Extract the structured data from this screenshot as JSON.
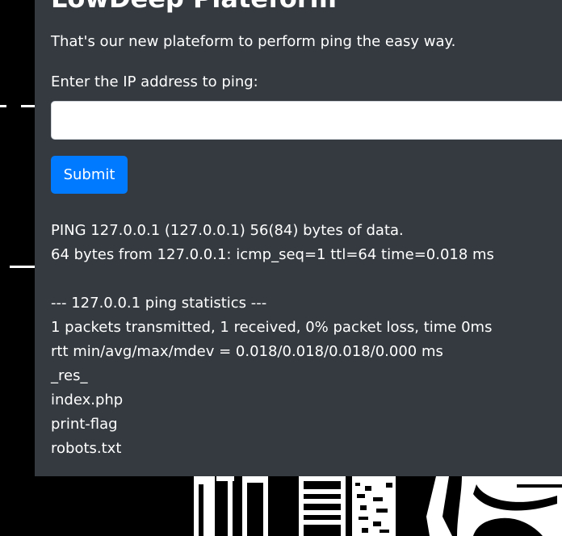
{
  "page": {
    "title": "LowDeep Plateform",
    "lead": "That's our new plateform to perform ping the easy way."
  },
  "form": {
    "ip_label": "Enter the IP address to ping:",
    "ip_value": "",
    "submit_label": "Submit"
  },
  "output": {
    "lines": [
      "PING 127.0.0.1 (127.0.0.1) 56(84) bytes of data.",
      "64 bytes from 127.0.0.1: icmp_seq=1 ttl=64 time=0.018 ms",
      "",
      "--- 127.0.0.1 ping statistics ---",
      "1 packets transmitted, 1 received, 0% packet loss, time 0ms",
      "rtt min/avg/max/mdev = 0.018/0.018/0.018/0.000 ms",
      "_res_",
      "index.php",
      "print-flag",
      "robots.txt"
    ]
  },
  "colors": {
    "panel_bg": "#343a40",
    "page_bg": "#000000",
    "button_bg": "#007bff",
    "text": "#ffffff"
  }
}
